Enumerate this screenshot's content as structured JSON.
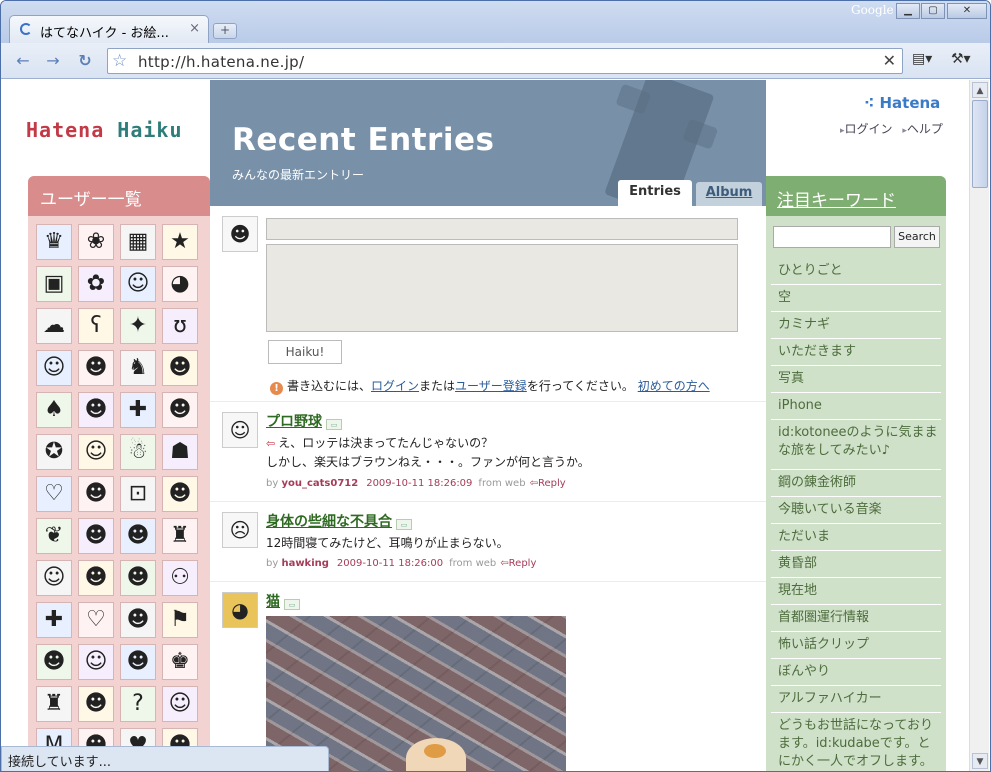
{
  "browser": {
    "tab_title": "はてなハイク - お絵...",
    "tab_close": "×",
    "newtab": "+",
    "google_label": "Google",
    "url": "http://h.hatena.ne.jp/",
    "status": "接続しています..."
  },
  "site": {
    "logo_part1": "Hatena",
    "logo_part2": "Haiku",
    "hatena_logo": "⁖ Hatena",
    "login_link": "ログイン",
    "help_link": "ヘルプ"
  },
  "left": {
    "header": "ユーザー一覧",
    "icons": [
      "♛",
      "❀",
      "▦",
      "★",
      "▣",
      "✿",
      "☺",
      "◕",
      "☁",
      "ʕ",
      "✦",
      "ʊ",
      "☺",
      "☻",
      "♞",
      "☻",
      "♠",
      "☻",
      "✚",
      "☻",
      "✪",
      "☺",
      "☃",
      "☗",
      "♡",
      "☻",
      "⊡",
      "☻",
      "❦",
      "☻",
      "☻",
      "♜",
      "☺",
      "☻",
      "☻",
      "⚇",
      "✚",
      "♡",
      "☻",
      "⚑",
      "☻",
      "☺",
      "☻",
      "♚",
      "♜",
      "☻",
      "?",
      "☺",
      "M",
      "☻",
      "♥",
      "☻"
    ]
  },
  "hero": {
    "title": "Recent Entries",
    "subtitle": "みんなの最新エントリー",
    "tab_entries": "Entries",
    "tab_album": "Album"
  },
  "compose": {
    "keyword_placeholder": "",
    "body_placeholder": "",
    "submit": "Haiku!",
    "notice_prefix": "書き込むには、",
    "login_link": "ログイン",
    "notice_mid": "または",
    "register_link": "ユーザー登録",
    "notice_suffix": "を行ってください。",
    "first_time_link": "初めての方へ"
  },
  "entries": [
    {
      "title": "プロ野球",
      "line1": "え、ロッテは決まってたんじゃないの？",
      "line2": "しかし、楽天はブラウンねえ・・・。ファンが何と言うか。",
      "user": "you_cats0712",
      "timestamp": "2009-10-11 18:26:09",
      "source": "from web",
      "reply": "Reply"
    },
    {
      "title": "身体の些細な不具合",
      "line1": "12時間寝てみたけど、耳鳴りが止まらない。",
      "user": "hawking",
      "timestamp": "2009-10-11 18:26:00",
      "source": "from web",
      "reply": "Reply"
    },
    {
      "title": "猫"
    }
  ],
  "right": {
    "header": "注目キーワード",
    "search_button": "Search",
    "keywords": [
      "ひとりごと",
      "空",
      "カミナギ",
      "いただきます",
      "写真",
      "iPhone",
      "id:kotoneeのように気ままな旅をしてみたい♪",
      "鋼の錬金術師",
      "今聴いている音楽",
      "ただいま",
      "黄昏部",
      "現在地",
      "首都圏運行情報",
      "怖い話クリップ",
      "ぼんやり",
      "アルファハイカー",
      "どうもお世話になっております。id:kudabeです。とにかく一人でオフします。"
    ]
  },
  "colors": {
    "left_header": "#d88c8c",
    "left_bg": "#f3d2d2",
    "hero_bg": "#7891a8",
    "right_header": "#7fae72",
    "right_bg": "#cfe1c9",
    "entry_title": "#2f6a22",
    "user_link": "#a43c58"
  }
}
